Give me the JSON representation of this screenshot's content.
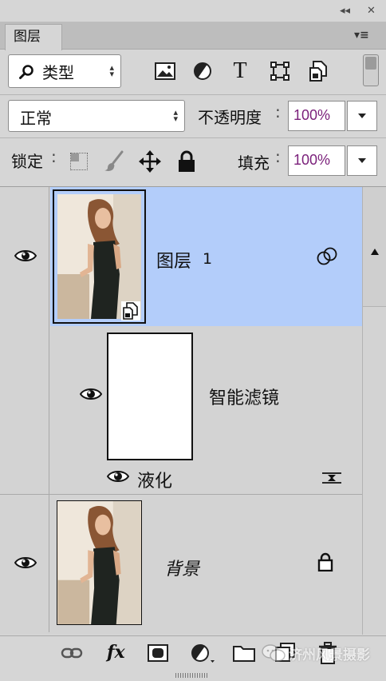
{
  "panel": {
    "tab_label": "图层",
    "collapse_glyph": "◂◂",
    "close_glyph": "✕",
    "menu_glyph": "▾≡"
  },
  "filter": {
    "type_label": "类型",
    "icons": [
      "image-filter-icon",
      "adjustment-filter-icon",
      "type-filter-icon",
      "shape-filter-icon",
      "smart-object-filter-icon"
    ]
  },
  "blend": {
    "mode": "正常",
    "opacity_label": "不透明度",
    "opacity_value": "100%"
  },
  "lock": {
    "label": "锁定",
    "fill_label": "填充",
    "fill_value": "100%"
  },
  "layers": [
    {
      "name": "图层",
      "number": "1",
      "selected": true,
      "smart_object": true
    },
    {
      "name": "智能滤镜",
      "type": "smart-filter-mask"
    },
    {
      "name": "液化",
      "type": "filter-effect"
    },
    {
      "name": "背景",
      "locked": true
    }
  ],
  "colors": {
    "selection": "#b3cdfa",
    "panel_bg": "#d6d6d6",
    "list_bg": "#d3d3d3"
  },
  "footer": {
    "fx_label": "fx",
    "watermark": "济州风景摄影"
  }
}
